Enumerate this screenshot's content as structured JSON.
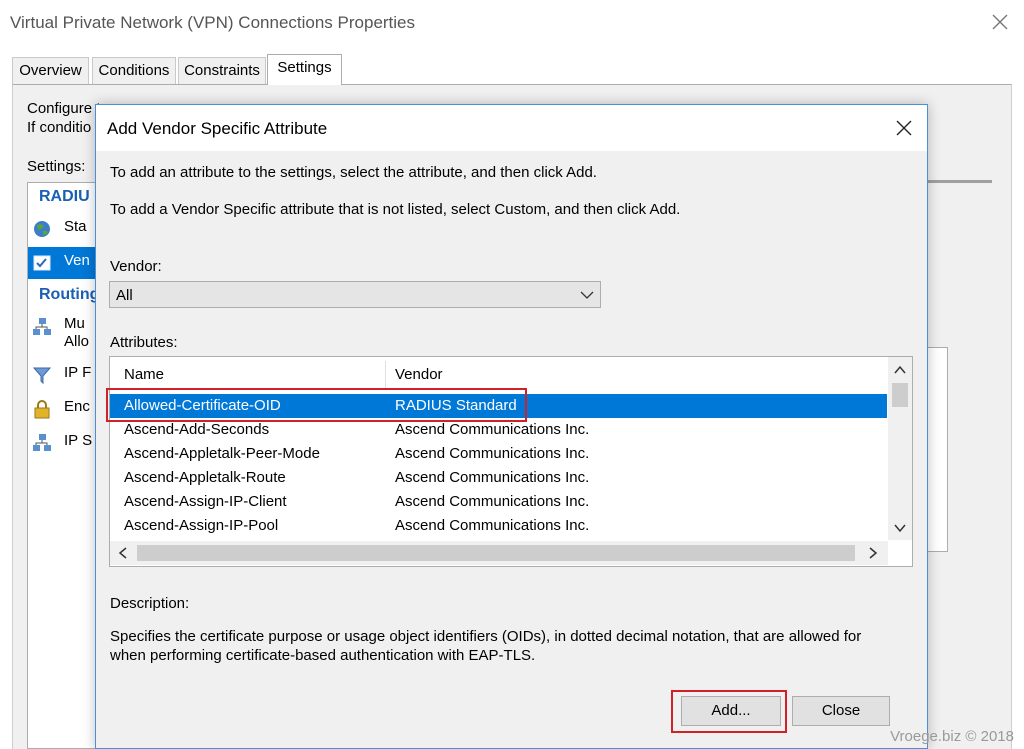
{
  "parent_window": {
    "title": "Virtual Private Network (VPN) Connections Properties",
    "tabs": [
      "Overview",
      "Conditions",
      "Constraints",
      "Settings"
    ],
    "active_tab": "Settings",
    "desc_line1": "Configure t",
    "desc_line2": "If conditio",
    "settings_label": "Settings:",
    "categories": {
      "radius_heading": "RADIU",
      "routing_heading": "Routing",
      "items": [
        {
          "label": "Sta",
          "icon": "globe-icon"
        },
        {
          "label": "Ven",
          "icon": "checkbox-icon"
        },
        {
          "label": "Mu",
          "label2": "Allo",
          "icon": "network-icon"
        },
        {
          "label": "IP F",
          "icon": "filter-icon"
        },
        {
          "label": "Enc",
          "icon": "lock-icon"
        },
        {
          "label": "IP S",
          "icon": "network-icon"
        }
      ]
    }
  },
  "dialog": {
    "title": "Add Vendor Specific Attribute",
    "instruction1": "To add an attribute to the settings, select the attribute, and then click Add.",
    "instruction2": "To add a Vendor Specific attribute that is not listed, select Custom, and then click Add.",
    "vendor_label": "Vendor:",
    "vendor_value": "All",
    "attributes_label": "Attributes:",
    "columns": {
      "name": "Name",
      "vendor": "Vendor"
    },
    "rows": [
      {
        "name": "Allowed-Certificate-OID",
        "vendor": "RADIUS Standard",
        "selected": true
      },
      {
        "name": "Ascend-Add-Seconds",
        "vendor": "Ascend Communications Inc."
      },
      {
        "name": "Ascend-Appletalk-Peer-Mode",
        "vendor": "Ascend Communications Inc."
      },
      {
        "name": "Ascend-Appletalk-Route",
        "vendor": "Ascend Communications Inc."
      },
      {
        "name": "Ascend-Assign-IP-Client",
        "vendor": "Ascend Communications Inc."
      },
      {
        "name": "Ascend-Assign-IP-Pool",
        "vendor": "Ascend Communications Inc."
      }
    ],
    "description_label": "Description:",
    "description_text": "Specifies the certificate purpose or usage object identifiers (OIDs), in dotted decimal notation, that are allowed for when performing certificate-based authentication with EAP-TLS.",
    "add_label": "Add...",
    "close_label": "Close"
  },
  "watermark": "Vroege.biz © 2018",
  "colors": {
    "selection": "#0078d7",
    "highlight_box": "#d0202a",
    "heading_blue": "#1a5fb4"
  }
}
